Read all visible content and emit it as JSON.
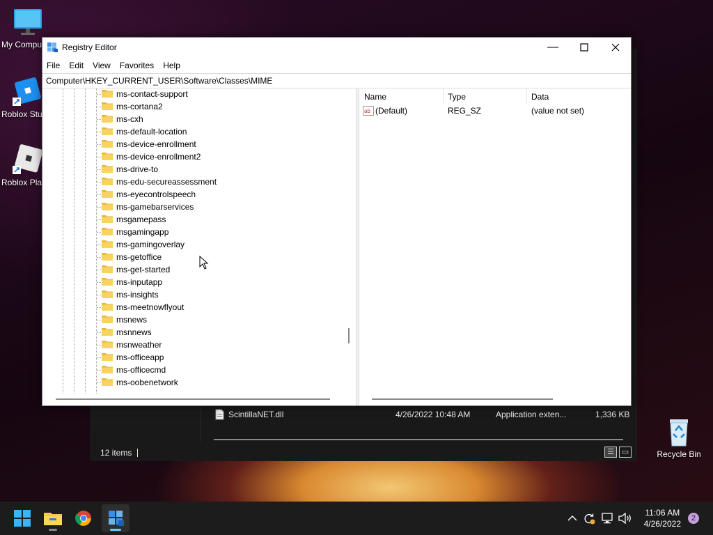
{
  "desktop": {
    "icons": [
      {
        "label": "My Compu",
        "icon": "monitor-icon"
      },
      {
        "label": "Roblox Stu",
        "icon": "roblox-studio-icon"
      },
      {
        "label": "Roblox Pla",
        "icon": "roblox-player-icon"
      },
      {
        "label": "Recycle Bin",
        "icon": "recycle-bin-icon"
      }
    ]
  },
  "explorer": {
    "file": {
      "name": "ScintillaNET.dll",
      "date": "4/26/2022 10:48 AM",
      "type": "Application exten...",
      "size": "1,336 KB"
    },
    "status": "12 items"
  },
  "regedit": {
    "title": "Registry Editor",
    "menu": [
      "File",
      "Edit",
      "View",
      "Favorites",
      "Help"
    ],
    "address": "Computer\\HKEY_CURRENT_USER\\Software\\Classes\\MIME",
    "tree": [
      "ms-contact-support",
      "ms-cortana2",
      "ms-cxh",
      "ms-default-location",
      "ms-device-enrollment",
      "ms-device-enrollment2",
      "ms-drive-to",
      "ms-edu-secureassessment",
      "ms-eyecontrolspeech",
      "ms-gamebarservices",
      "msgamepass",
      "msgamingapp",
      "ms-gamingoverlay",
      "ms-getoffice",
      "ms-get-started",
      "ms-inputapp",
      "ms-insights",
      "ms-meetnowflyout",
      "msnews",
      "msnnews",
      "msnweather",
      "ms-officeapp",
      "ms-officecmd",
      "ms-oobenetwork"
    ],
    "columns": {
      "name": "Name",
      "type": "Type",
      "data": "Data"
    },
    "values": [
      {
        "name": "(Default)",
        "type": "REG_SZ",
        "data": "(value not set)"
      }
    ]
  },
  "taskbar": {
    "apps": [
      "start-icon",
      "file-explorer-icon",
      "chrome-icon",
      "regedit-icon"
    ],
    "time": "11:06 AM",
    "date": "4/26/2022",
    "notifications": "2"
  }
}
